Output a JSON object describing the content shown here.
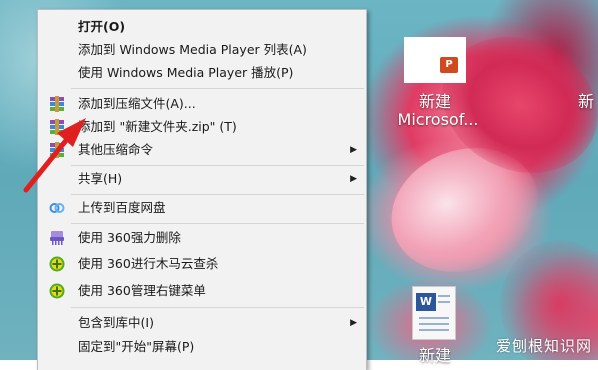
{
  "menu": {
    "items": [
      {
        "label": "打开(O)"
      },
      {
        "label": "添加到 Windows Media Player 列表(A)"
      },
      {
        "label": "使用 Windows Media Player 播放(P)"
      },
      {
        "label": "添加到压缩文件(A)..."
      },
      {
        "label": "添加到 \"新建文件夹.zip\" (T)"
      },
      {
        "label": "其他压缩命令"
      },
      {
        "label": "共享(H)"
      },
      {
        "label": "上传到百度网盘"
      },
      {
        "label": "使用 360强力删除"
      },
      {
        "label": "使用 360进行木马云查杀"
      },
      {
        "label": "使用 360管理右键菜单"
      },
      {
        "label": "包含到库中(I)"
      },
      {
        "label": "固定到\"开始\"屏幕(P)"
      }
    ]
  },
  "desktop": {
    "icon1_line1": "新建",
    "icon1_line2": "Microsof...",
    "icon2_line1": "新",
    "icon3_line1": "新建",
    "ppt_badge": "P",
    "word_badge": "W"
  },
  "watermark": "爱刨根知识网",
  "colors": {
    "menu_bg": "#f2f2f2",
    "arrow": "#e02020"
  }
}
